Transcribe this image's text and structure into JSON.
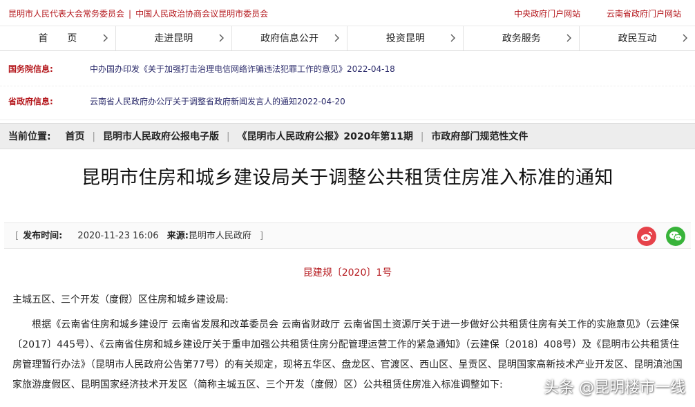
{
  "topbar": {
    "left_items": [
      "昆明市人民代表大会常务委员会",
      "|",
      "中国人民政治协商会议昆明市委员会"
    ],
    "right_items": [
      "中央政府门户网站",
      "云南省政府门户网站"
    ]
  },
  "nav": {
    "items": [
      "首　　页",
      "走进昆明",
      "政府信息公开",
      "投资昆明",
      "政务服务",
      "政民互动"
    ]
  },
  "news": {
    "state": {
      "label": "国务院信息:",
      "text": "中办国办印发《关于加强打击治理电信网络诈骗违法犯罪工作的意见》2022-04-18"
    },
    "province": {
      "label": "省政府信息:",
      "text": "云南省人民政府办公厅关于调整省政府新闻发言人的通知2022-04-20"
    }
  },
  "breadcrumb": {
    "lead": "当前位置:",
    "items": [
      "首页",
      "昆明市人民政府公报电子版",
      "《昆明市人民政府公报》2020年第11期",
      "市政府部门规范性文件"
    ],
    "sep": "|"
  },
  "article": {
    "title": "昆明市住房和城乡建设局关于调整公共租赁住房准入标准的通知",
    "meta": {
      "bracket_open": "[",
      "publish_label": "发布时间:",
      "publish_time": "2020-11-23 16:06",
      "source_label": "来源:",
      "source": "昆明市人民政府",
      "bracket_close": "]"
    },
    "doc_no": "昆建规〔2020〕1号",
    "addressee": "主城五区、三个开发（度假）区住房和城乡建设局:",
    "body": "根据《云南省住房和城乡建设厅 云南省发展和改革委员会 云南省财政厅 云南省国土资源厅关于进一步做好公共租赁住房有关工作的实施意见》（云建保〔2017〕445号）、《云南省住房和城乡建设厅关于重申加强公共租赁住房分配管理运营工作的紧急通知》（云建保〔2018〕408号）及《昆明市公共租赁住房管理暂行办法》（昆明市人民政府公告第77号）的有关规定，现将五华区、盘龙区、官渡区、西山区、呈贡区、昆明国家高新技术产业开发区、昆明滇池国家旅游度假区、昆明国家经济技术开发区（简称主城五区、三个开发（度假）区）公共租赁住房准入标准调整如下:"
  },
  "share": {
    "icons": [
      "weibo-icon",
      "wechat-icon"
    ],
    "colors": {
      "weibo": "#e6424a",
      "wechat": "#38b33a"
    }
  },
  "watermark": "头条 @昆明楼市一线",
  "colors": {
    "accent": "#b4161b",
    "link": "#2a2a6a"
  }
}
